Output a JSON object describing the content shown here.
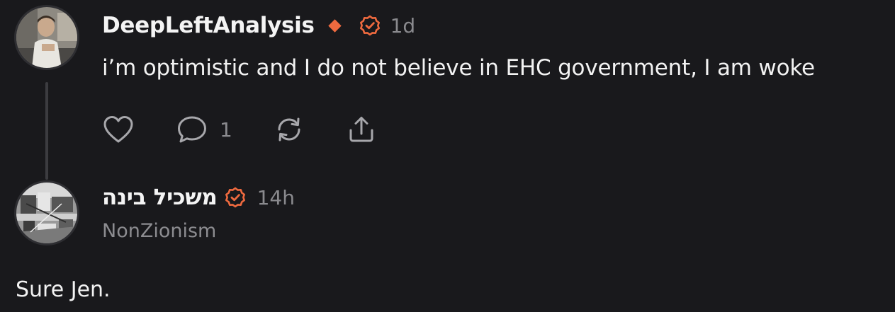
{
  "post": {
    "author": "DeepLeftAnalysis",
    "timestamp": "1d",
    "text": "i’m optimistic and I do not believe in EHC government, I am woke",
    "comment_count": "1",
    "icons": {
      "badge": "diamond-icon",
      "verified": "verified-check-icon",
      "like": "heart-icon",
      "comment": "comment-bubble-icon",
      "repost": "repost-icon",
      "share": "share-icon"
    }
  },
  "reply": {
    "author": "משכיל בינה",
    "timestamp": "14h",
    "subtitle": "NonZionism",
    "text": "Sure Jen."
  },
  "colors": {
    "background": "#19191c",
    "accent": "#ef6a3f",
    "text_primary": "#f2f2f2",
    "text_muted": "#8a8a8e",
    "icon": "#a7a7ab"
  }
}
